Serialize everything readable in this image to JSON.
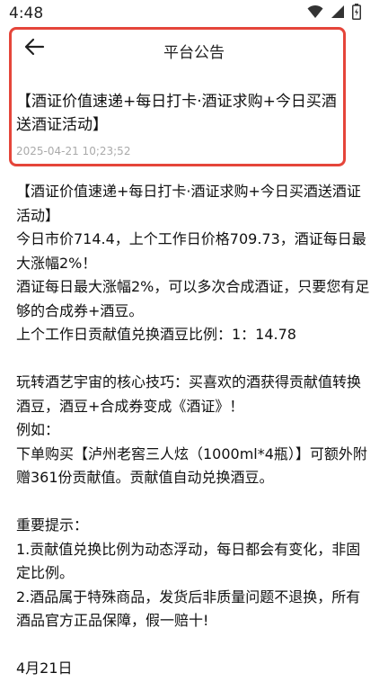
{
  "status": {
    "time": "4:48"
  },
  "header": {
    "title": "平台公告"
  },
  "notice": {
    "title": "【酒证价值速递+每日打卡·酒证求购+今日买酒送酒证活动】",
    "date": "2025-04-21 10;23;52"
  },
  "content": {
    "lines": [
      "【酒证价值速递+每日打卡·酒证求购+今日买酒送酒证活动】",
      "今日市价714.4，上个工作日价格709.73，酒证每日最大涨幅2%！",
      "酒证每日最大涨幅2%，可以多次合成酒证，只要您有足够的合成券+酒豆。",
      "上个工作日贡献值兑换酒豆比例：1：14.78",
      "",
      "玩转酒艺宇宙的核心技巧：买喜欢的酒获得贡献值转换酒豆，酒豆+合成券变成《酒证》！",
      "例如：",
      "下单购买【泸州老窖三人炫（1000ml*4瓶）】可额外附赠361份贡献值。贡献值自动兑换酒豆。",
      "",
      "重要提示：",
      "1.贡献值兑换比例为动态浮动，每日都会有变化，非固定比例。",
      "2.酒品属于特殊商品，发货后非质量问题不退换，所有酒品官方正品保障，假一赔十!",
      "",
      "4月21日"
    ]
  },
  "colors": {
    "highlight": "#e5453a",
    "date": "#aaaaaa"
  },
  "icons": [
    "wifi-icon",
    "signal-icon",
    "battery-icon",
    "back-arrow-icon"
  ]
}
